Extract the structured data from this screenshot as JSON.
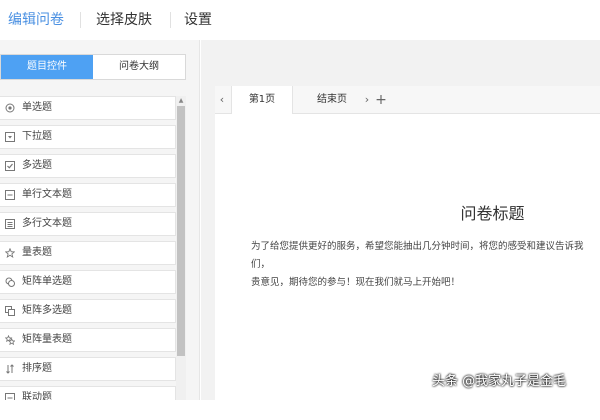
{
  "topnav": {
    "edit_label": "编辑问卷",
    "skin_label": "选择皮肤",
    "settings_label": "设置"
  },
  "sidebar": {
    "segment": {
      "controls_label": "题目控件",
      "outline_label": "问卷大纲"
    },
    "items": [
      {
        "label": "单选题",
        "icon": "radio-icon"
      },
      {
        "label": "下拉题",
        "icon": "dropdown-icon"
      },
      {
        "label": "多选题",
        "icon": "checkbox-icon"
      },
      {
        "label": "单行文本题",
        "icon": "single-line-text-icon"
      },
      {
        "label": "多行文本题",
        "icon": "multi-line-text-icon"
      },
      {
        "label": "量表题",
        "icon": "star-icon"
      },
      {
        "label": "矩阵单选题",
        "icon": "matrix-radio-icon"
      },
      {
        "label": "矩阵多选题",
        "icon": "matrix-checkbox-icon"
      },
      {
        "label": "矩阵量表题",
        "icon": "matrix-star-icon"
      },
      {
        "label": "排序题",
        "icon": "sort-icon"
      },
      {
        "label": "联动题",
        "icon": "linkage-icon"
      }
    ]
  },
  "main": {
    "tabs": [
      {
        "label": "第1页"
      },
      {
        "label": "结束页"
      }
    ],
    "survey_title": "问卷标题",
    "survey_desc": "为了给您提供更好的服务，希望您能抽出几分钟时间，将您的感受和建议告诉我们，\n贵意见，期待您的参与！现在我们就马上开始吧！"
  },
  "watermark": "头条 @我家丸子是金毛",
  "colors": {
    "accent": "#4a90e2",
    "segment_active": "#4ea1f3"
  }
}
